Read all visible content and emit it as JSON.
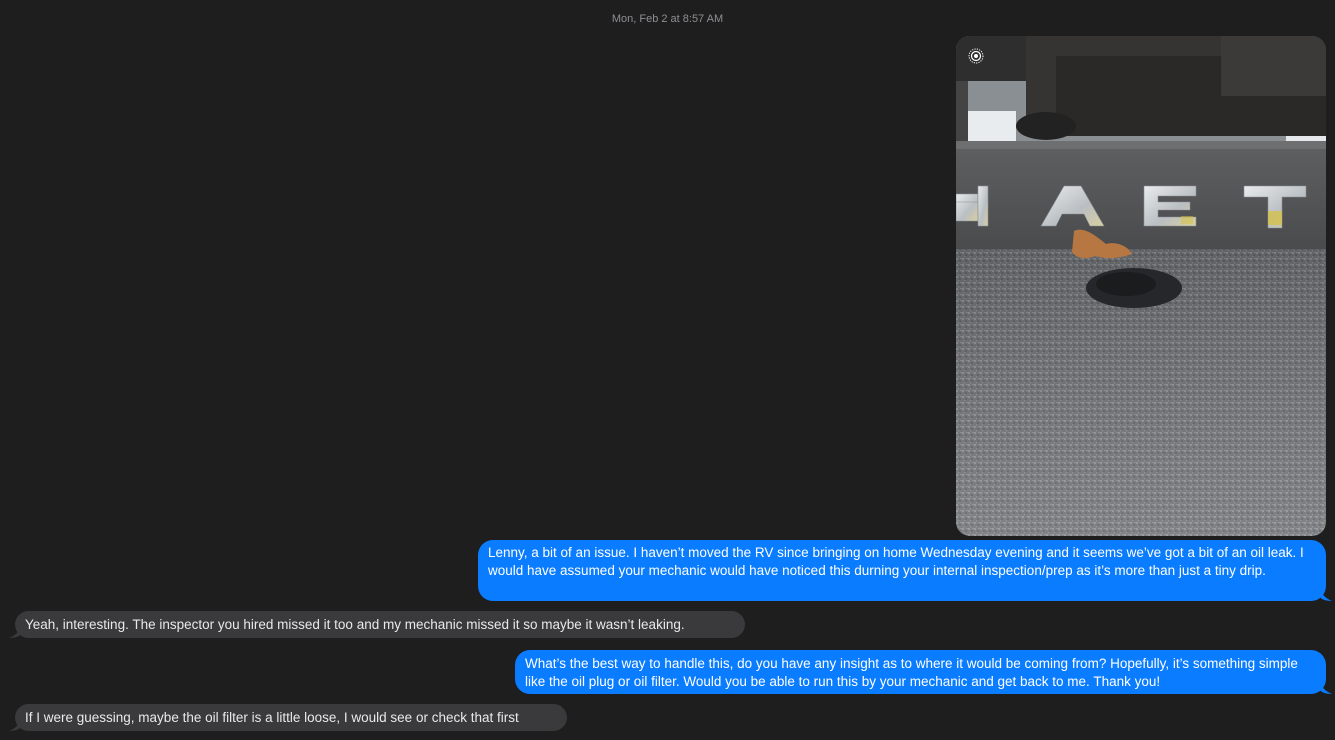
{
  "conversation": {
    "timestamp": "Mon, Feb 2 at 8:57 AM",
    "photo": {
      "icon": "live-photo-icon",
      "sign_letters": [
        "H",
        "A",
        "E",
        "T"
      ]
    },
    "messages": [
      {
        "sender": "me",
        "text": "Lenny, a bit of an issue. I haven’t moved the RV since bringing on home Wednesday evening and it seems we’ve got a bit of an oil leak. I would have assumed your mechanic would have noticed this durning your internal inspection/prep as it’s more than just a tiny drip."
      },
      {
        "sender": "other",
        "text": "Yeah, interesting. The inspector you hired missed it too and my mechanic missed it so maybe it wasn’t leaking."
      },
      {
        "sender": "me",
        "text": "What’s the best way to handle this, do you have any insight as to where it would be coming from? Hopefully, it’s something simple like the oil plug or oil filter. Would you be able to run this by your mechanic and get back to me. Thank you!"
      },
      {
        "sender": "other",
        "text": "If I were guessing, maybe the oil filter is a little loose, I would see or check that first"
      }
    ]
  },
  "colors": {
    "background": "#1e1e1e",
    "sent_bubble": "#0a7cff",
    "received_bubble": "#3a3a3c",
    "timestamp": "#8e8e93"
  }
}
